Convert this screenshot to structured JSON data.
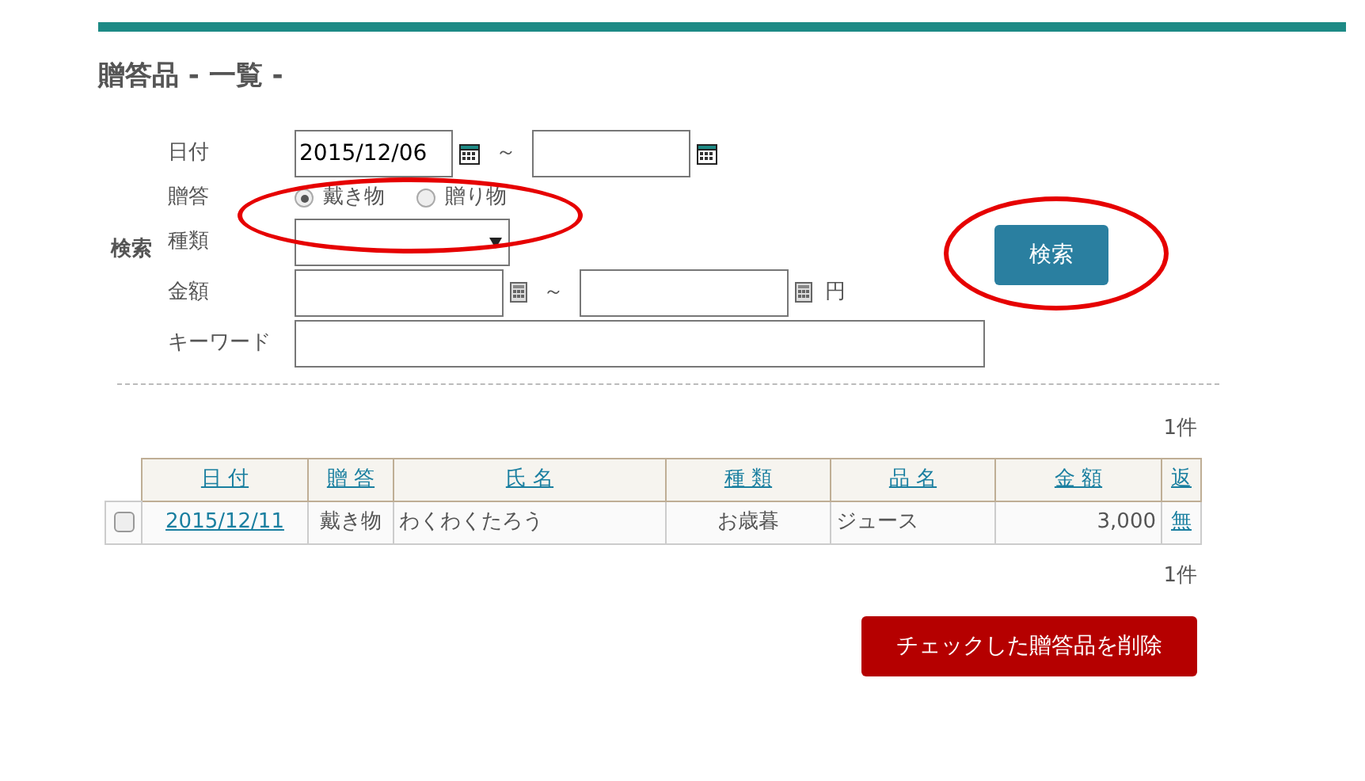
{
  "title": "贈答品 - 一覧 -",
  "search": {
    "section_label": "検索",
    "date": {
      "label": "日付",
      "from": "2015/12/06",
      "separator": "～"
    },
    "gift_type": {
      "label": "贈答",
      "highlighted": true,
      "options": [
        {
          "label": "戴き物",
          "selected": true
        },
        {
          "label": "贈り物",
          "selected": false
        }
      ]
    },
    "category": {
      "label": "種類"
    },
    "amount": {
      "label": "金額",
      "separator": "～",
      "unit": "円"
    },
    "keyword": {
      "label": "キーワード"
    },
    "button": {
      "label": "検索",
      "highlighted": true
    }
  },
  "count_top": "1件",
  "table": {
    "columns": [
      "日 付",
      "贈 答",
      "氏 名",
      "種 類",
      "品 名",
      "金 額",
      "返"
    ],
    "rows": [
      {
        "checked": false,
        "cells": [
          "2015/12/11",
          "戴き物",
          "わくわくたろう",
          "お歳暮",
          "ジュース",
          "3,000",
          "無"
        ]
      }
    ]
  },
  "count_bottom": "1件",
  "delete_button": "チェックした贈答品を削除"
}
